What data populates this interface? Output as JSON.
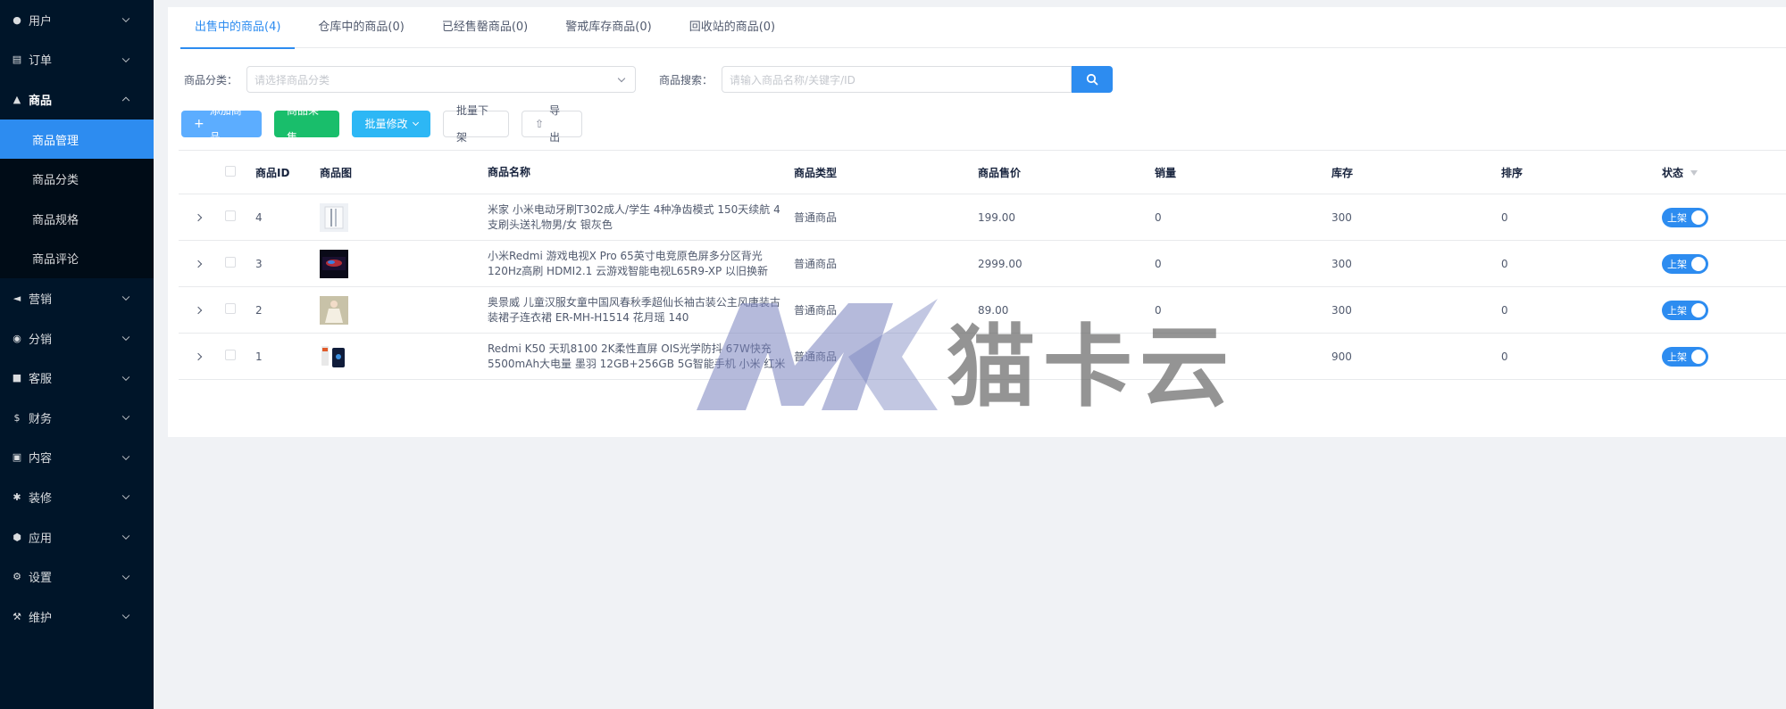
{
  "sidebar": {
    "items": [
      {
        "label": "用户",
        "icon": "user-icon"
      },
      {
        "label": "订单",
        "icon": "cart-icon"
      },
      {
        "label": "商品",
        "icon": "goods-icon"
      },
      {
        "label": "营销",
        "icon": "marketing-icon"
      },
      {
        "label": "分销",
        "icon": "distribution-icon"
      },
      {
        "label": "客服",
        "icon": "chat-icon"
      },
      {
        "label": "财务",
        "icon": "dollar-icon"
      },
      {
        "label": "内容",
        "icon": "book-icon"
      },
      {
        "label": "装修",
        "icon": "decorate-icon"
      },
      {
        "label": "应用",
        "icon": "cube-icon"
      },
      {
        "label": "设置",
        "icon": "gear-icon"
      },
      {
        "label": "维护",
        "icon": "wrench-icon"
      }
    ],
    "submenu": [
      "商品管理",
      "商品分类",
      "商品规格",
      "商品评论"
    ]
  },
  "tabs": [
    "出售中的商品(4)",
    "仓库中的商品(0)",
    "已经售罄商品(0)",
    "警戒库存商品(0)",
    "回收站的商品(0)"
  ],
  "filters": {
    "category_label": "商品分类：",
    "category_placeholder": "请选择商品分类",
    "search_label": "商品搜索：",
    "search_placeholder": "请输入商品名称/关键字/ID"
  },
  "actions": {
    "add": "添加商品",
    "collect": "商品采集",
    "batch_edit": "批量修改",
    "batch_off": "批量下架",
    "export": "导出"
  },
  "table": {
    "headers": {
      "id": "商品ID",
      "image": "商品图",
      "name": "商品名称",
      "type": "商品类型",
      "price": "商品售价",
      "sales": "销量",
      "stock": "库存",
      "sort": "排序",
      "status": "状态"
    },
    "rows": [
      {
        "id": "4",
        "name": "米家 小米电动牙刷T302成人/学生 4种净齿模式 150天续航 4支刷头送礼物男/女 银灰色",
        "type": "普通商品",
        "price": "199.00",
        "sales": "0",
        "stock": "300",
        "sort": "0",
        "status": "上架"
      },
      {
        "id": "3",
        "name": "小米Redmi 游戏电视X Pro 65英寸电竞原色屏多分区背光 120Hz高刷 HDMI2.1 云游戏智能电视L65R9-XP 以旧换新",
        "type": "普通商品",
        "price": "2999.00",
        "sales": "0",
        "stock": "300",
        "sort": "0",
        "status": "上架"
      },
      {
        "id": "2",
        "name": "奥景威 儿童汉服女童中国风春秋季超仙长袖古装公主风唐装古装裙子连衣裙 ER-MH-H1514 花月瑶 140",
        "type": "普通商品",
        "price": "89.00",
        "sales": "0",
        "stock": "300",
        "sort": "0",
        "status": "上架"
      },
      {
        "id": "1",
        "name": "Redmi K50 天玑8100 2K柔性直屏 OIS光学防抖 67W快充 5500mAh大电量 墨羽 12GB+256GB 5G智能手机 小米 红米",
        "type": "普通商品",
        "price": "",
        "sales": "",
        "stock": "900",
        "sort": "0",
        "status": "上架"
      }
    ]
  },
  "watermark": "猫卡云",
  "colors": {
    "primary": "#2d8cf0",
    "sidebar": "#001529",
    "success": "#19be6b",
    "info": "#2db7f5"
  }
}
